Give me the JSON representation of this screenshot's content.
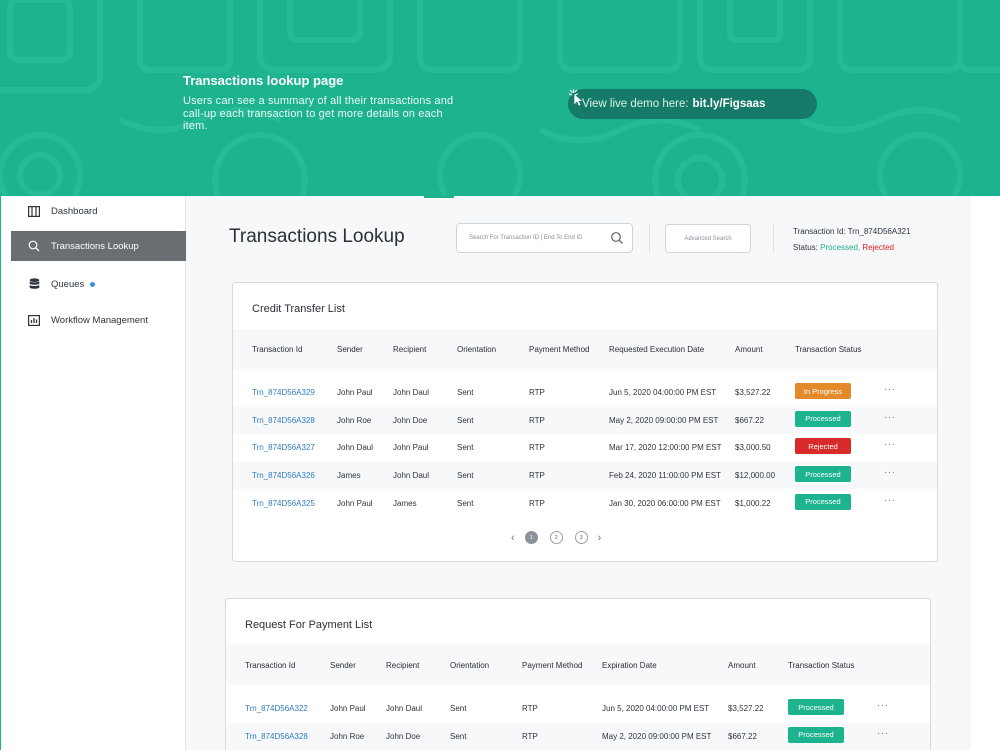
{
  "hero": {
    "title": "Transactions lookup page",
    "description": "Users can see a summary of all their transactions and call-up each transaction to get more details on each item.",
    "demo_label": "View live demo here:",
    "demo_link": "bit.ly/Figsaas"
  },
  "sidebar": {
    "items": [
      {
        "label": "Dashboard",
        "icon": "dashboard-icon"
      },
      {
        "label": "Transactions Lookup",
        "icon": "search-icon"
      },
      {
        "label": "Queues",
        "icon": "database-icon"
      },
      {
        "label": "Workflow Management",
        "icon": "chart-icon"
      }
    ]
  },
  "header": {
    "title": "Transactions Lookup",
    "search_placeholder": "Search For Transaction ID  |  End To End ID",
    "advanced_search": "Advanced Search",
    "txn_id_label": "Transaction Id: Trn_874D56A321",
    "status_label": "Status:",
    "status_processed": "Processed,",
    "status_rejected": "Rejected"
  },
  "credit_list": {
    "title": "Credit Transfer List",
    "columns": [
      "Transaction Id",
      "Sender",
      "Recipient",
      "Orientation",
      "Payment Method",
      "Requested Execution Date",
      "Amount",
      "Transaction Status"
    ],
    "rows": [
      {
        "id": "Trn_874D56A329",
        "sender": "John Paul",
        "recipient": "John Daul",
        "orientation": "Sent",
        "method": "RTP",
        "date": "Jun 5, 2020 04:00:00 PM EST",
        "amount": "$3,527.22",
        "status": "In Progress"
      },
      {
        "id": "Trn_874D56A328",
        "sender": "John Roe",
        "recipient": "John Doe",
        "orientation": "Sent",
        "method": "RTP",
        "date": "May 2, 2020 09:00:00 PM EST",
        "amount": "$667.22",
        "status": "Processed"
      },
      {
        "id": "Trn_874D56A327",
        "sender": "John Daul",
        "recipient": "John Paul",
        "orientation": "Sent",
        "method": "RTP",
        "date": "Mar 17, 2020 12:00:00 PM EST",
        "amount": "$3,000.50",
        "status": "Rejected"
      },
      {
        "id": "Trn_874D56A326",
        "sender": "James",
        "recipient": "John Daul",
        "orientation": "Sent",
        "method": "RTP",
        "date": "Feb 24, 2020 11:00:00 PM EST",
        "amount": "$12,000.00",
        "status": "Processed"
      },
      {
        "id": "Trn_874D56A325",
        "sender": "John Paul",
        "recipient": "James",
        "orientation": "Sent",
        "method": "RTP",
        "date": "Jan 30, 2020 06:00:00 PM EST",
        "amount": "$1,000.22",
        "status": "Processed"
      }
    ],
    "pages": [
      "1",
      "2",
      "3"
    ],
    "more": "···"
  },
  "rfp_list": {
    "title": "Request For Payment List",
    "columns": [
      "Transaction Id",
      "Sender",
      "Recipient",
      "Orientation",
      "Payment Method",
      "Expiration Date",
      "Amount",
      "Transaction Status"
    ],
    "rows": [
      {
        "id": "Trn_874D56A322",
        "sender": "John Paul",
        "recipient": "John Daul",
        "orientation": "Sent",
        "method": "RTP",
        "date": "Jun 5, 2020 04:00:00 PM EST",
        "amount": "$3,527.22",
        "status": "Processed"
      },
      {
        "id": "Trn_874D56A328",
        "sender": "John Roe",
        "recipient": "John Doe",
        "orientation": "Sent",
        "method": "RTP",
        "date": "May 2, 2020 09:00:00 PM EST",
        "amount": "$667.22",
        "status": "Processed"
      }
    ],
    "more": "···"
  },
  "colors": {
    "brand": "#1db38f",
    "in_progress": "#e38a2b",
    "processed": "#1db38f",
    "rejected": "#d92a2a",
    "link": "#2e7bbf"
  }
}
